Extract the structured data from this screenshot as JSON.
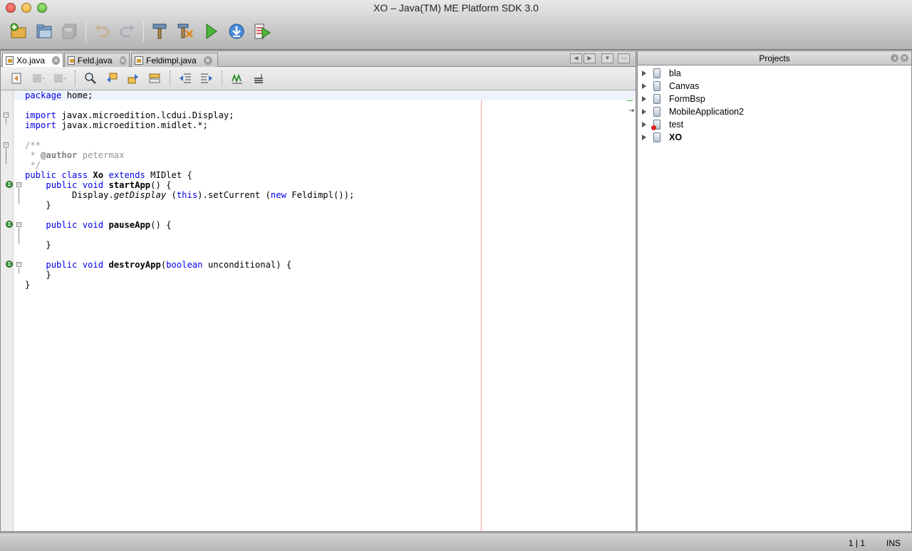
{
  "window": {
    "title": "XO – Java(TM) ME Platform SDK 3.0"
  },
  "toolbar": {
    "buttons": [
      "new-project",
      "open-project",
      "save-all",
      "undo",
      "redo",
      "build",
      "clean-build",
      "run",
      "deploy",
      "run-configuration"
    ]
  },
  "editor": {
    "tabs": [
      {
        "label": "Xo.java",
        "active": true
      },
      {
        "label": "Feld.java",
        "active": false
      },
      {
        "label": "Feldimpl.java",
        "active": false
      }
    ],
    "code": {
      "l1_kw": "package",
      "l1_rest": " home;",
      "l3_kw": "import",
      "l3_rest": " javax.microedition.lcdui.Display;",
      "l4_kw": "import",
      "l4_rest": " javax.microedition.midlet.*;",
      "l6": "/**",
      "l7_pre": " * ",
      "l7_tag": "@author",
      "l7_val": " petermax",
      "l8": " */",
      "l9_kw1": "public",
      "l9_sp1": " ",
      "l9_kw2": "class",
      "l9_sp2": " ",
      "l9_name": "Xo",
      "l9_sp3": " ",
      "l9_kw3": "extends",
      "l9_rest": " MIDlet {",
      "l10_ind": "    ",
      "l10_kw1": "public",
      "l10_sp1": " ",
      "l10_kw2": "void",
      "l10_sp2": " ",
      "l10_name": "startApp",
      "l10_rest": "() {",
      "l11_pre": "         Display.",
      "l11_ital": "getDisplay",
      "l11_mid": " (",
      "l11_kw1": "this",
      "l11_mid2": ").setCurrent (",
      "l11_kw2": "new",
      "l11_end": " Feldimpl());",
      "l12": "    }",
      "l14_ind": "    ",
      "l14_kw1": "public",
      "l14_sp1": " ",
      "l14_kw2": "void",
      "l14_sp2": " ",
      "l14_name": "pauseApp",
      "l14_rest": "() {",
      "l16": "    }",
      "l18_ind": "    ",
      "l18_kw1": "public",
      "l18_sp1": " ",
      "l18_kw2": "void",
      "l18_sp2": " ",
      "l18_name": "destroyApp",
      "l18_p": "(",
      "l18_kw3": "boolean",
      "l18_rest": " unconditional) {",
      "l19": "    }",
      "l20": "}"
    }
  },
  "projects": {
    "title": "Projects",
    "items": [
      {
        "label": "bla",
        "bold": false,
        "error": false
      },
      {
        "label": "Canvas",
        "bold": false,
        "error": false
      },
      {
        "label": "FormBsp",
        "bold": false,
        "error": false
      },
      {
        "label": "MobileApplication2",
        "bold": false,
        "error": false
      },
      {
        "label": "test",
        "bold": false,
        "error": true
      },
      {
        "label": "XO",
        "bold": true,
        "error": false
      }
    ]
  },
  "status": {
    "position": "1 | 1",
    "mode": "INS"
  }
}
